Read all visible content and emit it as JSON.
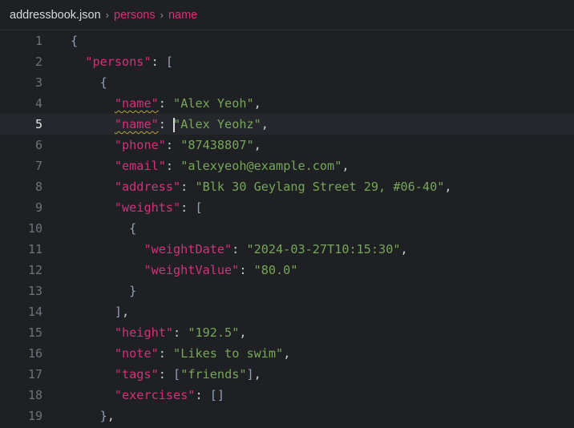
{
  "breadcrumb": {
    "file": "addressbook.json",
    "path": [
      "persons",
      "name"
    ],
    "separator": "›"
  },
  "colors": {
    "key": "#d6307a",
    "string": "#76a758",
    "punct": "#c9ccd2",
    "bracket": "#8fa2b8",
    "gutter": "#6e727a"
  },
  "editor": {
    "active_line": 5,
    "lines": [
      {
        "n": "1",
        "indent": "",
        "tokens": [
          [
            "b",
            "{"
          ]
        ]
      },
      {
        "n": "2",
        "indent": "  ",
        "tokens": [
          [
            "k",
            "\"persons\""
          ],
          [
            "p",
            ": "
          ],
          [
            "b",
            "["
          ]
        ]
      },
      {
        "n": "3",
        "indent": "    ",
        "tokens": [
          [
            "b",
            "{"
          ]
        ]
      },
      {
        "n": "4",
        "indent": "      ",
        "tokens": [
          [
            "kw",
            "\"name\""
          ],
          [
            "p",
            ": "
          ],
          [
            "s",
            "\"Alex Yeoh\""
          ],
          [
            "p",
            ","
          ]
        ]
      },
      {
        "n": "5",
        "indent": "      ",
        "tokens": [
          [
            "kw",
            "\"name\""
          ],
          [
            "p",
            ": "
          ],
          [
            "c",
            ""
          ],
          [
            "s",
            "\"Alex Yeohz\""
          ],
          [
            "p",
            ","
          ]
        ]
      },
      {
        "n": "6",
        "indent": "      ",
        "tokens": [
          [
            "k",
            "\"phone\""
          ],
          [
            "p",
            ": "
          ],
          [
            "s",
            "\"87438807\""
          ],
          [
            "p",
            ","
          ]
        ]
      },
      {
        "n": "7",
        "indent": "      ",
        "tokens": [
          [
            "k",
            "\"email\""
          ],
          [
            "p",
            ": "
          ],
          [
            "s",
            "\"alexyeoh@example.com\""
          ],
          [
            "p",
            ","
          ]
        ]
      },
      {
        "n": "8",
        "indent": "      ",
        "tokens": [
          [
            "k",
            "\"address\""
          ],
          [
            "p",
            ": "
          ],
          [
            "s",
            "\"Blk 30 Geylang Street 29, #06-40\""
          ],
          [
            "p",
            ","
          ]
        ]
      },
      {
        "n": "9",
        "indent": "      ",
        "tokens": [
          [
            "k",
            "\"weights\""
          ],
          [
            "p",
            ": "
          ],
          [
            "b",
            "["
          ]
        ]
      },
      {
        "n": "10",
        "indent": "        ",
        "tokens": [
          [
            "b",
            "{"
          ]
        ]
      },
      {
        "n": "11",
        "indent": "          ",
        "tokens": [
          [
            "k",
            "\"weightDate\""
          ],
          [
            "p",
            ": "
          ],
          [
            "s",
            "\"2024-03-27T10:15:30\""
          ],
          [
            "p",
            ","
          ]
        ]
      },
      {
        "n": "12",
        "indent": "          ",
        "tokens": [
          [
            "k",
            "\"weightValue\""
          ],
          [
            "p",
            ": "
          ],
          [
            "s",
            "\"80.0\""
          ]
        ]
      },
      {
        "n": "13",
        "indent": "        ",
        "tokens": [
          [
            "b",
            "}"
          ]
        ]
      },
      {
        "n": "14",
        "indent": "      ",
        "tokens": [
          [
            "b",
            "]"
          ],
          [
            "p",
            ","
          ]
        ]
      },
      {
        "n": "15",
        "indent": "      ",
        "tokens": [
          [
            "k",
            "\"height\""
          ],
          [
            "p",
            ": "
          ],
          [
            "s",
            "\"192.5\""
          ],
          [
            "p",
            ","
          ]
        ]
      },
      {
        "n": "16",
        "indent": "      ",
        "tokens": [
          [
            "k",
            "\"note\""
          ],
          [
            "p",
            ": "
          ],
          [
            "s",
            "\"Likes to swim\""
          ],
          [
            "p",
            ","
          ]
        ]
      },
      {
        "n": "17",
        "indent": "      ",
        "tokens": [
          [
            "k",
            "\"tags\""
          ],
          [
            "p",
            ": "
          ],
          [
            "b",
            "["
          ],
          [
            "s",
            "\"friends\""
          ],
          [
            "b",
            "]"
          ],
          [
            "p",
            ","
          ]
        ]
      },
      {
        "n": "18",
        "indent": "      ",
        "tokens": [
          [
            "k",
            "\"exercises\""
          ],
          [
            "p",
            ": "
          ],
          [
            "b",
            "[]"
          ]
        ]
      },
      {
        "n": "19",
        "indent": "    ",
        "tokens": [
          [
            "b",
            "}"
          ],
          [
            "p",
            ","
          ]
        ]
      }
    ]
  }
}
